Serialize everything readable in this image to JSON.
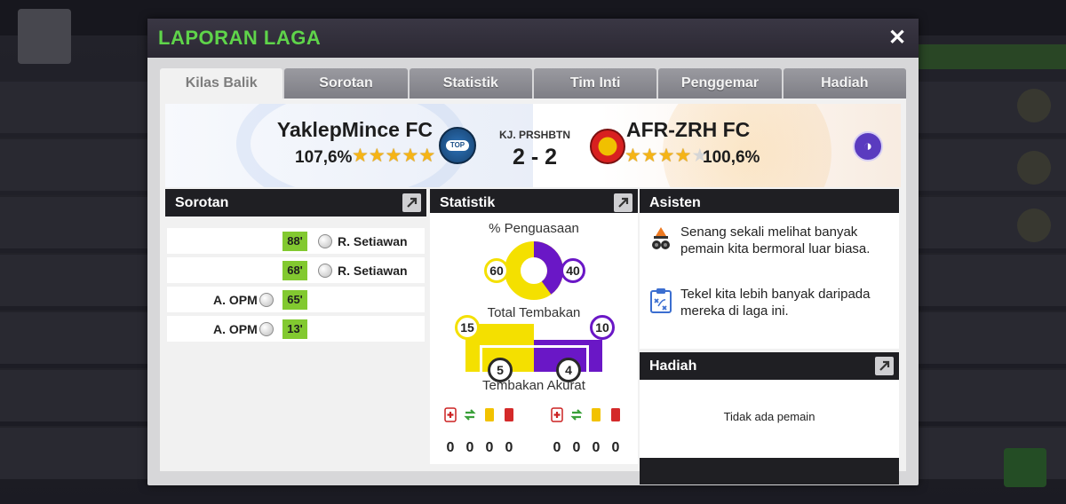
{
  "modal": {
    "title": "LAPORAN LAGA",
    "close_label": "✕"
  },
  "tabs": [
    {
      "label": "Kilas Balik",
      "active": true
    },
    {
      "label": "Sorotan",
      "active": false
    },
    {
      "label": "Statistik",
      "active": false
    },
    {
      "label": "Tim Inti",
      "active": false
    },
    {
      "label": "Penggemar",
      "active": false
    },
    {
      "label": "Hadiah",
      "active": false
    }
  ],
  "match": {
    "home": {
      "name": "YaklepMince FC",
      "rating": "107,6%",
      "stars_filled": 4.5,
      "stars_total": 5
    },
    "away": {
      "name": "AFR-ZRH FC",
      "rating": "100,6%",
      "stars_filled": 3.5,
      "stars_total": 5
    },
    "score_label": "KJ. PRSHBTN",
    "score": "2 - 2"
  },
  "sorotan": {
    "title": "Sorotan",
    "events": [
      {
        "side": "away",
        "minute": "88'",
        "player": "R. Setiawan"
      },
      {
        "side": "away",
        "minute": "68'",
        "player": "R. Setiawan"
      },
      {
        "side": "home",
        "minute": "65'",
        "player": "A. OPM"
      },
      {
        "side": "home",
        "minute": "13'",
        "player": "A. OPM"
      }
    ]
  },
  "statistik": {
    "title": "Statistik",
    "possession_label": "% Penguasaan",
    "possession": {
      "home": 60,
      "away": 40
    },
    "total_shots_label": "Total Tembakan",
    "total_shots": {
      "home": 15,
      "away": 10
    },
    "on_target_label": "Tembakan Akurat",
    "on_target": {
      "home": 5,
      "away": 4
    },
    "events": {
      "home": {
        "injuries": "0",
        "substitutions": "0",
        "yellow_cards": "0",
        "red_cards": "0"
      },
      "away": {
        "injuries": "0",
        "substitutions": "0",
        "yellow_cards": "0",
        "red_cards": "0"
      }
    },
    "colors": {
      "home": "#f4e000",
      "away": "#6a17c6"
    }
  },
  "asisten": {
    "title": "Asisten",
    "messages": [
      {
        "icon": "coach-icon",
        "text": "Senang sekali melihat banyak pemain kita bermoral luar biasa."
      },
      {
        "icon": "tactics-clipboard-icon",
        "text": "Tekel kita lebih banyak daripada mereka di laga ini."
      }
    ]
  },
  "hadiah": {
    "title": "Hadiah",
    "empty_text": "Tidak ada pemain"
  }
}
